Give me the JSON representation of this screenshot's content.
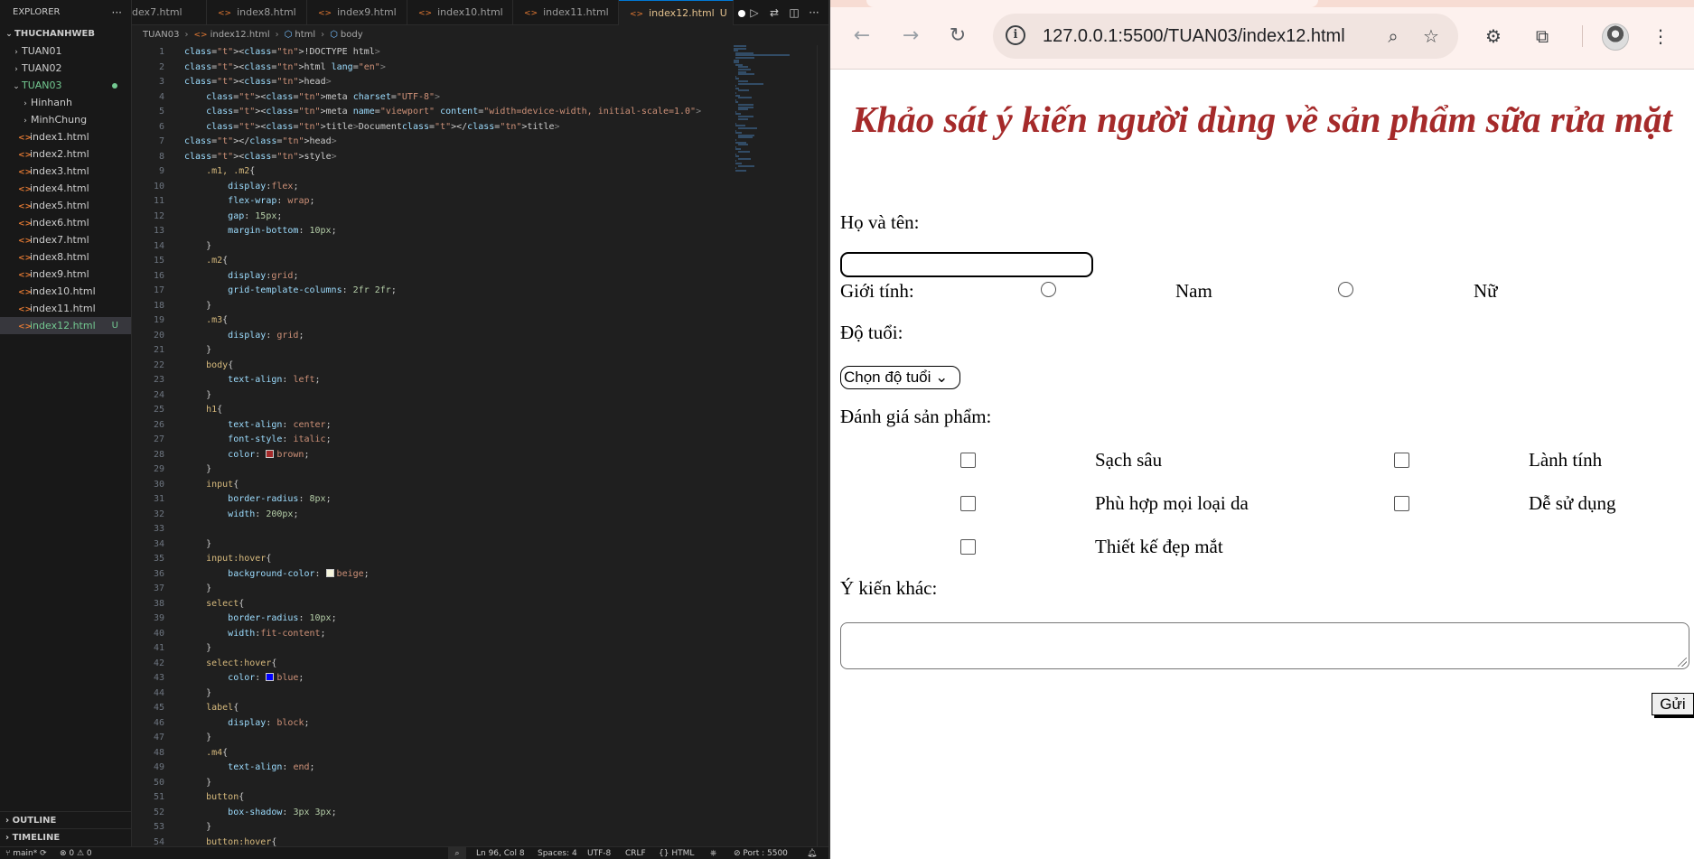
{
  "explorer": {
    "title": "EXPLORER",
    "workspace": "THUCHANHWEB",
    "items": [
      {
        "label": "TUAN01",
        "type": "folder"
      },
      {
        "label": "TUAN02",
        "type": "folder"
      },
      {
        "label": "TUAN03",
        "type": "folder-open"
      },
      {
        "label": "Hinhanh",
        "type": "folder"
      },
      {
        "label": "MinhChung",
        "type": "folder"
      },
      {
        "label": "index1.html"
      },
      {
        "label": "index2.html"
      },
      {
        "label": "index3.html"
      },
      {
        "label": "index4.html"
      },
      {
        "label": "index5.html"
      },
      {
        "label": "index6.html"
      },
      {
        "label": "index7.html"
      },
      {
        "label": "index8.html"
      },
      {
        "label": "index9.html"
      },
      {
        "label": "index10.html"
      },
      {
        "label": "index11.html"
      },
      {
        "label": "index12.html",
        "badge": "U"
      }
    ],
    "outline": "OUTLINE",
    "timeline": "TIMELINE"
  },
  "tabs": [
    {
      "label": "dex7.html"
    },
    {
      "label": "index8.html"
    },
    {
      "label": "index9.html"
    },
    {
      "label": "index10.html"
    },
    {
      "label": "index11.html"
    },
    {
      "label": "index12.html",
      "badge": "U"
    }
  ],
  "breadcrumb": {
    "folder": "TUAN03",
    "file": "index12.html",
    "node1": "html",
    "node2": "body"
  },
  "code_lines": [
    "<!DOCTYPE html>",
    "<html lang=\"en\">",
    "<head>",
    "    <meta charset=\"UTF-8\">",
    "    <meta name=\"viewport\" content=\"width=device-width, initial-scale=1.0\">",
    "    <title>Document</title>",
    "</head>",
    "<style>",
    "    .m1, .m2{",
    "        display:flex;",
    "        flex-wrap: wrap;",
    "        gap: 15px;",
    "        margin-bottom: 10px;",
    "    }",
    "    .m2{",
    "        display:grid;",
    "        grid-template-columns: 2fr 2fr;",
    "    }",
    "    .m3{",
    "        display: grid;",
    "    }",
    "    body{",
    "        text-align: left;",
    "    }",
    "    h1{",
    "        text-align: center;",
    "        font-style: italic;",
    "        color: brown;",
    "    }",
    "    input{",
    "        border-radius: 8px;",
    "        width: 200px;",
    "",
    "    }",
    "    input:hover{",
    "        background-color: beige;",
    "    }",
    "    select{",
    "        border-radius: 10px;",
    "        width:fit-content;",
    "    }",
    "    select:hover{",
    "        color: blue;",
    "    }",
    "    label{",
    "        display: block;",
    "    }",
    "    .m4{",
    "        text-align: end;",
    "    }",
    "    button{",
    "        box-shadow: 3px 3px;",
    "    }",
    "    button:hover{"
  ],
  "status": {
    "branch": "main*",
    "problems": "⊗ 0 ⚠ 0",
    "position": "Ln 96, Col 8",
    "spaces": "Spaces: 4",
    "encoding": "UTF-8",
    "eol": "CRLF",
    "language": "{} HTML",
    "port": "Port : 5500"
  },
  "browser": {
    "url": "127.0.0.1:5500/TUAN03/index12.html",
    "colors": {
      "heading": "#a52a2a",
      "toolbar": "#fdf1ee"
    }
  },
  "form": {
    "title": "Khảo sát ý kiến người dùng về sản phẩm sữa rửa mặt",
    "name_label": "Họ và tên:",
    "name_value": "",
    "gender_label": "Giới tính:",
    "gender_options": [
      "Nam",
      "Nữ"
    ],
    "age_label": "Độ tuổi:",
    "age_select": "Chọn độ tuổi",
    "rating_label": "Đánh giá sản phẩm:",
    "rating_options": [
      "Sạch sâu",
      "Lành tính",
      "Phù hợp mọi loại da",
      "Dễ sử dụng",
      "Thiết kế đẹp mắt"
    ],
    "other_label": "Ý kiến khác:",
    "submit_label": "Gửi"
  }
}
